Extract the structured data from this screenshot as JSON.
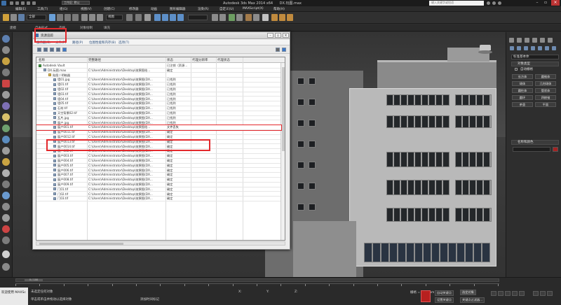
{
  "titlebar": {
    "workspace": "工作区: 默认",
    "app_title": "Autodesk 3ds Max  2014 x64",
    "file_name": "DX.玩图.max",
    "search_placeholder": "键入关键字或短语"
  },
  "menubar": {
    "items": [
      "编辑(E)",
      "工具(T)",
      "组(G)",
      "视图(V)",
      "创建(C)",
      "修改器",
      "动画",
      "图形编辑器",
      "渲染(R)",
      "自定义(U)",
      "MAXScript(X)",
      "帮助(H)"
    ]
  },
  "toolbar": {
    "filter_combo": "全部",
    "view_combo": "视图"
  },
  "ribbon": {
    "tabs": [
      "建模",
      "自由形式",
      "选择",
      "对象绘制",
      "填充"
    ]
  },
  "viewport": {
    "labels": [
      "[+]",
      "[透视]",
      "[真实]"
    ]
  },
  "dialog": {
    "title": "资源追踪",
    "menu": [
      "服务器(S)",
      "文件(F)",
      "路径(P)",
      "位图性能和内存(B)",
      "选项(T)"
    ],
    "columns": [
      "名称",
      "完整路径",
      "状态",
      "代理分辨率",
      "代理状态"
    ],
    "rows": [
      {
        "name": "Autodesk Vault",
        "path": "",
        "status": "已注销（资源...",
        "indent": 0,
        "icon": "vault-icon",
        "icon_class": "grn"
      },
      {
        "name": "DX.玩图.max",
        "path": "C:\\Users\\Administrator\\Desktop\\效果图绘...",
        "status": "确定",
        "indent": 1,
        "icon": "max-file-icon",
        "icon_class": ""
      },
      {
        "name": "贴图 / 明暗器",
        "path": "",
        "status": "",
        "indent": 2,
        "icon": "folder-icon",
        "icon_class": "folder"
      },
      {
        "name": "墙01.jpg",
        "path": "C:\\Users\\Administrator\\Desktop\\效果图(DX...",
        "status": "已找到",
        "indent": 3,
        "icon": "bitmap-icon",
        "icon_class": ""
      },
      {
        "name": "墙01.tif",
        "path": "C:\\Users\\Administrator\\Desktop\\效果图(DX...",
        "status": "已找到",
        "indent": 3,
        "icon": "bitmap-icon",
        "icon_class": ""
      },
      {
        "name": "墙02.tif",
        "path": "C:\\Users\\Administrator\\Desktop\\效果图(DX...",
        "status": "已找到",
        "indent": 3,
        "icon": "bitmap-icon",
        "icon_class": ""
      },
      {
        "name": "墙03.tif",
        "path": "C:\\Users\\Administrator\\Desktop\\效果图(DX...",
        "status": "已找到",
        "indent": 3,
        "icon": "bitmap-icon",
        "icon_class": ""
      },
      {
        "name": "墙04.tif",
        "path": "C:\\Users\\Administrator\\Desktop\\效果图(DX...",
        "status": "已找到",
        "indent": 3,
        "icon": "bitmap-icon",
        "icon_class": ""
      },
      {
        "name": "墙05.tif",
        "path": "C:\\Users\\Administrator\\Desktop\\效果图(DX...",
        "status": "已找到",
        "indent": 3,
        "icon": "bitmap-icon",
        "icon_class": ""
      },
      {
        "name": "石材.tif",
        "path": "C:\\Users\\Administrator\\Desktop\\效果图(DX...",
        "status": "已找到",
        "indent": 3,
        "icon": "bitmap-icon",
        "icon_class": ""
      },
      {
        "name": "天空背景02.tif",
        "path": "C:\\Users\\Administrator\\Desktop\\效果图(DX...",
        "status": "已找到",
        "indent": 3,
        "icon": "bitmap-icon",
        "icon_class": ""
      },
      {
        "name": "瓦片.jpg",
        "path": "C:\\Users\\Administrator\\Desktop\\效果图(DX...",
        "status": "已找到",
        "indent": 3,
        "icon": "bitmap-icon",
        "icon_class": ""
      },
      {
        "name": "窗户.jpg",
        "path": "C:\\Users\\Administrator\\Desktop\\效果图(DX...",
        "status": "已找到",
        "indent": 3,
        "icon": "bitmap-icon",
        "icon_class": ""
      },
      {
        "name": "窗户001.tif",
        "path": "C:\\Users\\Administrator\\Desktop\\效果图绘...",
        "status": "文件丢失",
        "indent": 3,
        "icon": "missing-bitmap-icon",
        "icon_class": "",
        "selected": true
      },
      {
        "name": "窗户0011.tif",
        "path": "C:\\Users\\Administrator\\Desktop\\效果图(DX...",
        "status": "确定",
        "indent": 3,
        "icon": "bitmap-icon",
        "icon_class": ""
      },
      {
        "name": "窗户0012.tif",
        "path": "C:\\Users\\Administrator\\Desktop\\效果图(DX...",
        "status": "确定",
        "indent": 3,
        "icon": "bitmap-icon",
        "icon_class": ""
      },
      {
        "name": "窗户0013.tif",
        "path": "C:\\Users\\Administrator\\Desktop\\效果图(DX...",
        "status": "确定",
        "indent": 3,
        "icon": "bitmap-icon",
        "icon_class": ""
      },
      {
        "name": "窗户0014.tif",
        "path": "C:\\Users\\Administrator\\Desktop\\效果图(DX...",
        "status": "确定",
        "indent": 3,
        "icon": "bitmap-icon",
        "icon_class": ""
      },
      {
        "name": "窗户002.tif",
        "path": "C:\\Users\\Administrator\\Desktop\\效果图(DX...",
        "status": "确定",
        "indent": 3,
        "icon": "bitmap-icon",
        "icon_class": ""
      },
      {
        "name": "窗户003.tif",
        "path": "C:\\Users\\Administrator\\Desktop\\效果图(DX...",
        "status": "确定",
        "indent": 3,
        "icon": "bitmap-icon",
        "icon_class": ""
      },
      {
        "name": "窗户004.tif",
        "path": "C:\\Users\\Administrator\\Desktop\\效果图(DX...",
        "status": "确定",
        "indent": 3,
        "icon": "bitmap-icon",
        "icon_class": ""
      },
      {
        "name": "窗户005.tif",
        "path": "C:\\Users\\Administrator\\Desktop\\效果图(DX...",
        "status": "确定",
        "indent": 3,
        "icon": "bitmap-icon",
        "icon_class": ""
      },
      {
        "name": "窗户006.tif",
        "path": "C:\\Users\\Administrator\\Desktop\\效果图(DX...",
        "status": "确定",
        "indent": 3,
        "icon": "bitmap-icon",
        "icon_class": ""
      },
      {
        "name": "窗户007.tif",
        "path": "C:\\Users\\Administrator\\Desktop\\效果图(DX...",
        "status": "确定",
        "indent": 3,
        "icon": "bitmap-icon",
        "icon_class": ""
      },
      {
        "name": "窗户008.tif",
        "path": "C:\\Users\\Administrator\\Desktop\\效果图(DX...",
        "status": "确定",
        "indent": 3,
        "icon": "bitmap-icon",
        "icon_class": ""
      },
      {
        "name": "窗户009.tif",
        "path": "C:\\Users\\Administrator\\Desktop\\效果图(DX...",
        "status": "确定",
        "indent": 3,
        "icon": "bitmap-icon",
        "icon_class": ""
      },
      {
        "name": "门01.tif",
        "path": "C:\\Users\\Administrator\\Desktop\\效果图(DX...",
        "status": "确定",
        "indent": 3,
        "icon": "bitmap-icon",
        "icon_class": ""
      },
      {
        "name": "门02.tif",
        "path": "C:\\Users\\Administrator\\Desktop\\效果图(DX...",
        "status": "确定",
        "indent": 3,
        "icon": "bitmap-icon",
        "icon_class": ""
      },
      {
        "name": "门03.tif",
        "path": "C:\\Users\\Administrator\\Desktop\\效果图(DX...",
        "status": "确定",
        "indent": 3,
        "icon": "bitmap-icon",
        "icon_class": ""
      }
    ]
  },
  "cmdpanel": {
    "dropdown": "标准基本体",
    "rollout_object_type": "对象类型",
    "autogrid": "自动栅格",
    "object_buttons": [
      "长方体",
      "圆锥体",
      "球体",
      "几何球体",
      "圆柱体",
      "管状体",
      "圆环",
      "四棱锥",
      "茶壶",
      "平面"
    ],
    "rollout_name_color": "名称和颜色"
  },
  "trackbar": {
    "frame": "0 / 100"
  },
  "statusbar": {
    "welcome": "欢迎使用 MAXSc",
    "prompt1": "未选定任何对象",
    "prompt2": "单击或单击并拖动以选择对象",
    "grid": "栅格 = 10.0mm",
    "autokey": "自动关键点",
    "selected": "选定对象",
    "setkey": "设置关键点",
    "keyfilter": "关键点过滤器...",
    "addtime": "添加时间标记"
  }
}
